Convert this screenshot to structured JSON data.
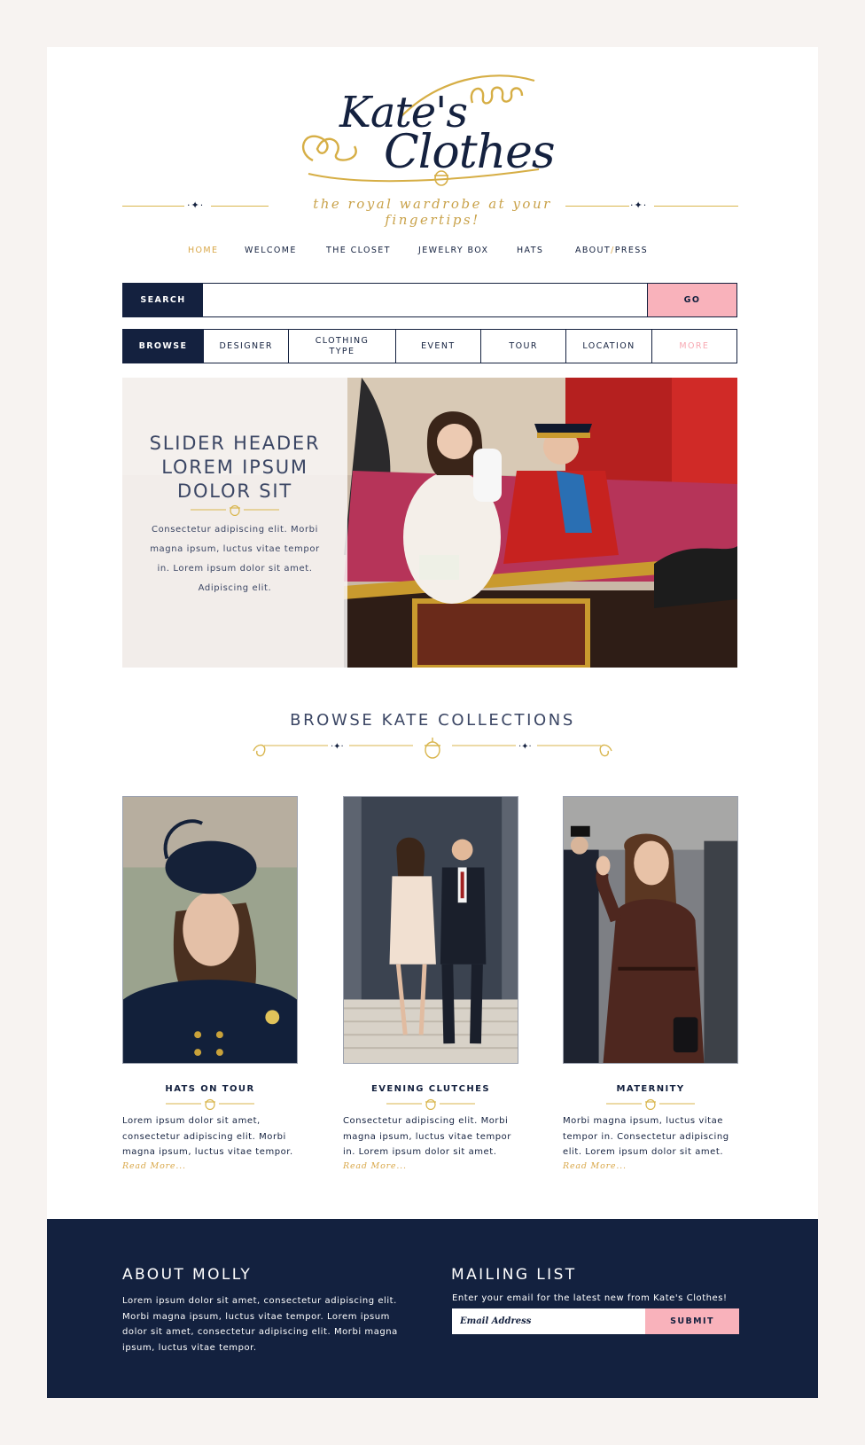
{
  "brand": {
    "logo_text": [
      "Kate's",
      "Clothes"
    ],
    "tagline": "the royal wardrobe at your fingertips!"
  },
  "nav": {
    "items": [
      "HOME",
      "WELCOME",
      "THE CLOSET",
      "JEWELRY BOX",
      "HATS"
    ],
    "about_press": [
      "ABOUT",
      "/",
      "PRESS"
    ],
    "active": "HOME"
  },
  "search": {
    "label": "SEARCH",
    "value": "",
    "go_label": "GO"
  },
  "browse": {
    "label": "BROWSE",
    "items": [
      "DESIGNER",
      "CLOTHING TYPE",
      "EVENT",
      "TOUR",
      "LOCATION",
      "MORE"
    ]
  },
  "slider": {
    "header_lines": [
      "SLIDER HEADER",
      "LOREM IPSUM",
      "DOLOR SIT"
    ],
    "body": "Consectetur adipiscing elit. Morbi magna ipsum, luctus vitae tempor in. Lorem ipsum dolor sit amet. Adipiscing elit."
  },
  "collections": {
    "title": "BROWSE KATE COLLECTIONS",
    "read_more": "Read More...",
    "items": [
      {
        "title": "HATS ON TOUR",
        "body": "Lorem ipsum dolor sit amet, consectetur adipiscing elit. Morbi magna ipsum, luctus vitae tempor."
      },
      {
        "title": "EVENING CLUTCHES",
        "body": "Consectetur adipiscing elit. Morbi magna ipsum, luctus vitae tempor in. Lorem ipsum dolor sit amet."
      },
      {
        "title": "MATERNITY",
        "body": "Morbi magna ipsum, luctus vitae tempor in. Consectetur adipiscing elit. Lorem ipsum dolor sit amet."
      }
    ]
  },
  "footer": {
    "about_title": "ABOUT MOLLY",
    "about_text": "Lorem ipsum dolor sit amet, consectetur adipiscing elit. Morbi magna ipsum, luctus vitae tempor. Lorem ipsum dolor sit amet, consectetur adipiscing elit. Morbi magna ipsum, luctus vitae tempor.",
    "mailing_title": "MAILING LIST",
    "mailing_text": "Enter your email for the latest new from Kate's Clothes!",
    "email_placeholder": "Email Address",
    "submit_label": "SUBMIT"
  },
  "colors": {
    "navy": "#14213f",
    "gold": "#d9a84a",
    "pink": "#f9b2bb",
    "background": "#f7f3f1"
  }
}
